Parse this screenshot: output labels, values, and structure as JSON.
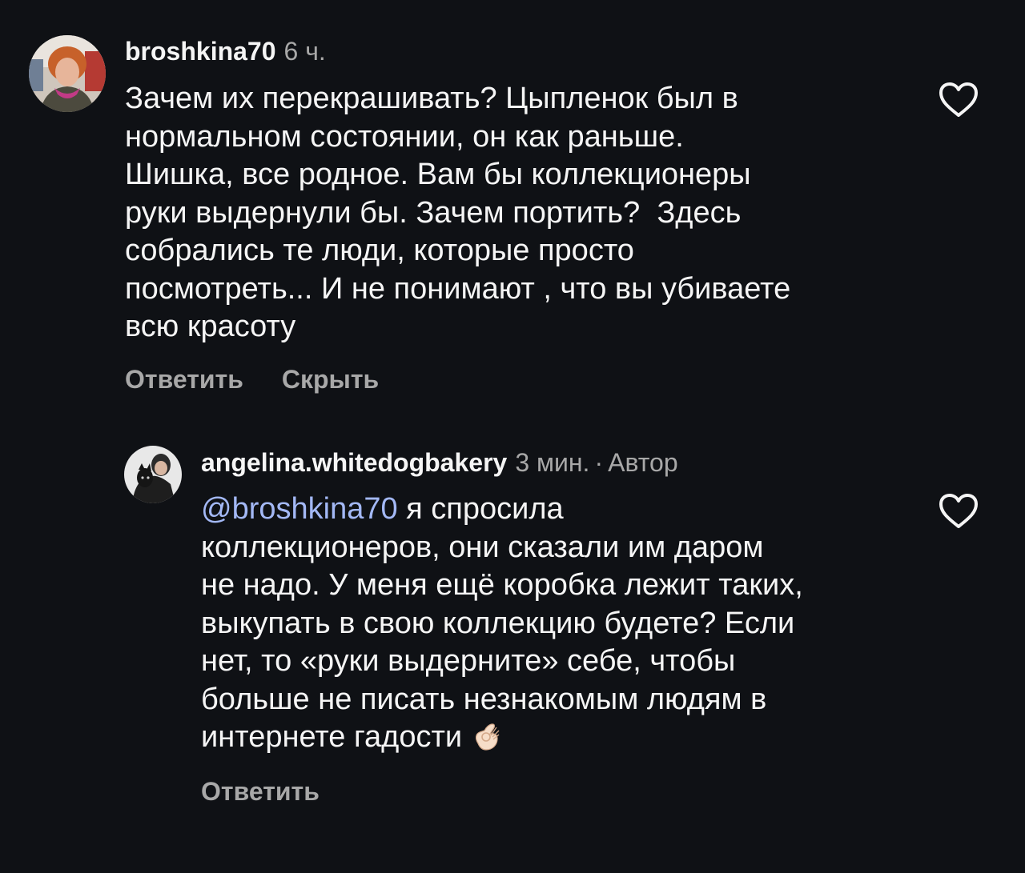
{
  "comments": [
    {
      "username": "broshkina70",
      "time": "6 ч.",
      "text": "Зачем их перекрашивать? Цыпленок был в\nнормальном состоянии, он как раньше.\nШишка, все родное. Вам бы коллекционеры\nруки выдернули бы. Зачем портить?  Здесь\nсобрались те люди, которые просто\nпосмотреть... И не понимают , что вы убиваете\nвсю красоту",
      "reply_label": "Ответить",
      "hide_label": "Скрыть",
      "like_icon": "heart-outline-icon"
    },
    {
      "username": "angelina.whitedogbakery",
      "time": "3 мин.",
      "separator": "·",
      "author_badge": "Автор",
      "mention": "@broshkina70",
      "text": " я спросила\nколлекционеров, они сказали им даром\nне надо. У меня ещё коробка лежит таких,\nвыкупать в свою коллекцию будете? Если\nнет, то «руки выдерните» себе, чтобы\nбольше не писать незнакомым людям в\nинтернете гадости",
      "emoji": "ok-hand-emoji",
      "reply_label": "Ответить",
      "like_icon": "heart-outline-icon"
    }
  ],
  "colors": {
    "background": "#0f1115",
    "text": "#f5f5f5",
    "muted": "#a8a8a8",
    "mention": "#a3b8f5"
  }
}
